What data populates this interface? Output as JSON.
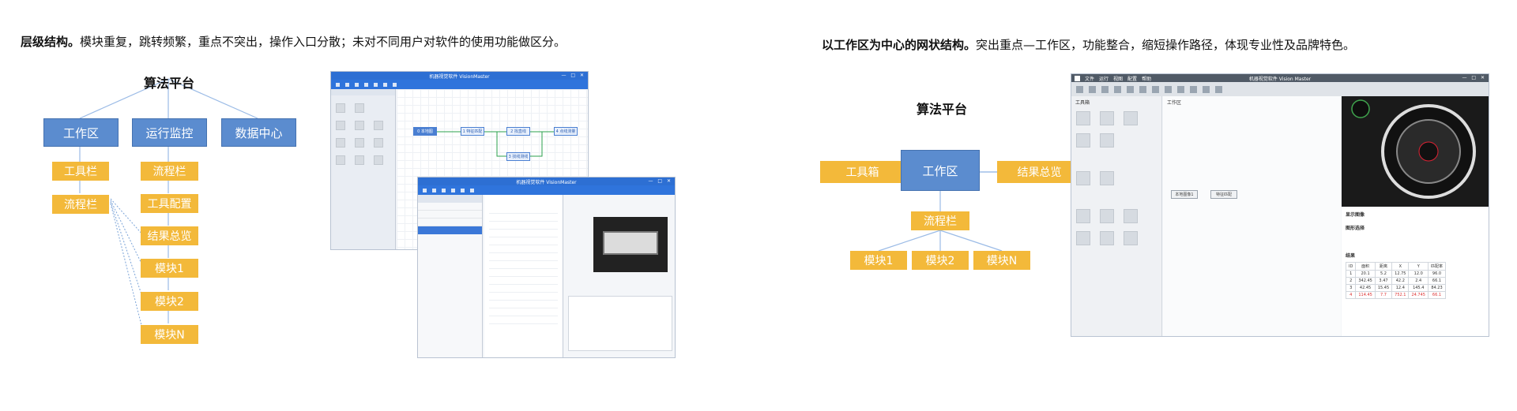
{
  "left": {
    "heading_bold": "层级结构。",
    "heading_rest": "模块重复，跳转频繁，重点不突出，操作入口分散；未对不同用户对软件的使用功能做区分。",
    "root": "算法平台",
    "level1": [
      "工作区",
      "运行监控",
      "数据中心"
    ],
    "workspace_children": [
      "工具栏",
      "流程栏"
    ],
    "monitor_children": [
      "流程栏",
      "工具配置",
      "结果总览",
      "模块1",
      "模块2",
      "模块N"
    ]
  },
  "right": {
    "heading_bold": "以工作区为中心的网状结构。",
    "heading_rest": "突出重点—工作区，功能整合，缩短操作路径，体现专业性及品牌特色。",
    "root": "算法平台",
    "center": "工作区",
    "left_node": "工具箱",
    "right_node": "结果总览",
    "bottom": "流程栏",
    "modules": [
      "模块1",
      "模块2",
      "模块N"
    ]
  },
  "screens": {
    "old_app_title": "机器视觉软件 VisionMaster",
    "old_flow_nodes": [
      "0 本地图",
      "1 特征匹配",
      "2 找直线",
      "4 点线测量",
      "3 找线测线"
    ],
    "new_app_title": "机器视觉软件 Vision Master",
    "new_menu": [
      "文件",
      "运行",
      "视图",
      "配置",
      "帮助"
    ],
    "new_canvas_nodes": [
      "本地图像1",
      "特征匹配"
    ],
    "new_panel_labels": [
      "工具箱",
      "工作区",
      "显示图像",
      "图形选择",
      "结果"
    ],
    "new_results_header": [
      "ID",
      "面积",
      "距离",
      "X",
      "Y",
      "匹配率"
    ],
    "new_results_rows": [
      [
        "1",
        "20.1",
        "5.2",
        "12.75",
        "12.0",
        "96.0"
      ],
      [
        "2",
        "342.45",
        "3.47",
        "42.2",
        "2.4",
        "66.1"
      ],
      [
        "3",
        "42.45",
        "15.45",
        "12.4",
        "145.4",
        "84.23"
      ],
      [
        "4",
        "114.45",
        "7.7",
        "752.1",
        "24.745",
        "66.1"
      ]
    ]
  }
}
